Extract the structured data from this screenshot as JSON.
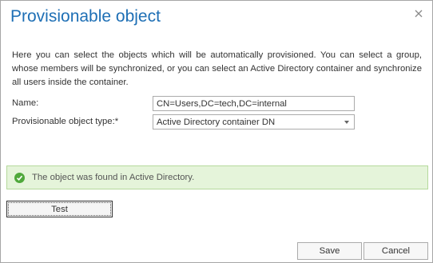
{
  "dialog": {
    "title": "Provisionable object",
    "description": "Here you can select the objects which will be automatically provisioned. You can select a group, whose members will be synchronized, or you can select an Active Directory container and synchronize all users inside the container."
  },
  "form": {
    "name_label": "Name:",
    "name_value": "CN=Users,DC=tech,DC=internal",
    "type_label": "Provisionable object type:*",
    "type_value": "Active Directory container DN"
  },
  "status": {
    "message": "The object was found in Active Directory.",
    "color": "#4fa83b"
  },
  "buttons": {
    "test_label": "Test",
    "save_label": "Save",
    "cancel_label": "Cancel"
  },
  "colors": {
    "title": "#1e6fb5",
    "status_background": "#e5f4da",
    "status_border": "#b5d99c"
  },
  "icons": {
    "close": "close-icon",
    "check": "check-circle-icon",
    "dropdown": "chevron-down-icon"
  }
}
